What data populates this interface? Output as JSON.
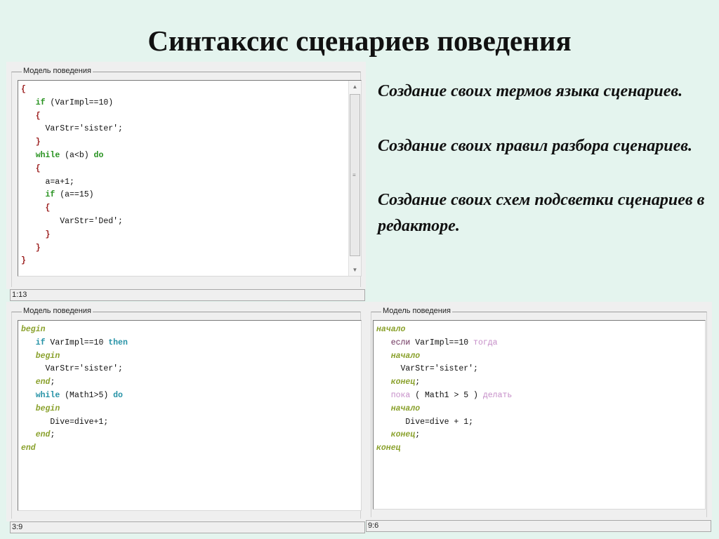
{
  "title": "Синтаксис сценариев поведения",
  "notes": [
    "Создание своих термов языка сценариев.",
    "Создание своих правил разбора сценариев.",
    "Создание своих схем подсветки сценариев в редакторе."
  ],
  "colors": {
    "keyword_green": "#27921f",
    "keyword_teal": "#2592a6",
    "keyword_olive": "#8aa12c",
    "keyword_pink": "#c68ec8",
    "brace_red": "#9c1f1f",
    "background": "#e4f4ee"
  },
  "panels": [
    {
      "label": "Модель поведения",
      "status": "1:13",
      "lines": [
        [
          {
            "t": "{",
            "c": "brace"
          }
        ],
        [
          {
            "t": "   "
          },
          {
            "t": "if",
            "c": "kwg"
          },
          {
            "t": " (VarImpl==10)"
          }
        ],
        [
          {
            "t": "   "
          },
          {
            "t": "{",
            "c": "brace"
          }
        ],
        [
          {
            "t": "     VarStr='sister';"
          }
        ],
        [
          {
            "t": "   "
          },
          {
            "t": "}",
            "c": "brace"
          }
        ],
        [
          {
            "t": "   "
          },
          {
            "t": "while",
            "c": "kwg"
          },
          {
            "t": " (a<b) "
          },
          {
            "t": "do",
            "c": "kwg"
          }
        ],
        [
          {
            "t": "   "
          },
          {
            "t": "{",
            "c": "brace"
          }
        ],
        [
          {
            "t": "     a=a+1;"
          }
        ],
        [
          {
            "t": "     "
          },
          {
            "t": "if",
            "c": "kwg"
          },
          {
            "t": " (a==15)"
          }
        ],
        [
          {
            "t": "     "
          },
          {
            "t": "{",
            "c": "brace"
          }
        ],
        [
          {
            "t": "        VarStr='Ded';"
          }
        ],
        [
          {
            "t": "     "
          },
          {
            "t": "}",
            "c": "brace"
          }
        ],
        [
          {
            "t": "   "
          },
          {
            "t": "}",
            "c": "brace"
          }
        ],
        [
          {
            "t": "}",
            "c": "brace"
          }
        ]
      ]
    },
    {
      "label": "Модель поведения",
      "status": "3:9",
      "lines": [
        [
          {
            "t": "begin",
            "c": "kwo"
          }
        ],
        [
          {
            "t": "   "
          },
          {
            "t": "if",
            "c": "kwt"
          },
          {
            "t": " VarImpl==10 "
          },
          {
            "t": "then",
            "c": "kwt"
          }
        ],
        [
          {
            "t": "   "
          },
          {
            "t": "begin",
            "c": "kwo"
          }
        ],
        [
          {
            "t": "     VarStr='sister';"
          }
        ],
        [
          {
            "t": "   "
          },
          {
            "t": "end",
            "c": "kwo"
          },
          {
            "t": ";"
          }
        ],
        [
          {
            "t": "   "
          },
          {
            "t": "while",
            "c": "kwt"
          },
          {
            "t": " (Math1>5) "
          },
          {
            "t": "do",
            "c": "kwt"
          }
        ],
        [
          {
            "t": "   "
          },
          {
            "t": "begin",
            "c": "kwo"
          }
        ],
        [
          {
            "t": "      Dive=dive+1;"
          }
        ],
        [
          {
            "t": "   "
          },
          {
            "t": "end",
            "c": "kwo"
          },
          {
            "t": ";"
          }
        ],
        [
          {
            "t": "end",
            "c": "kwo"
          }
        ]
      ]
    },
    {
      "label": "Модель поведения",
      "status": "9:6",
      "lines": [
        [
          {
            "t": "начало",
            "c": "kwo"
          }
        ],
        [
          {
            "t": "   "
          },
          {
            "t": "если",
            "c": "kwr"
          },
          {
            "t": " VarImpl==10 "
          },
          {
            "t": "тогда",
            "c": "kwp"
          }
        ],
        [
          {
            "t": "   "
          },
          {
            "t": "начало",
            "c": "kwo"
          }
        ],
        [
          {
            "t": "     VarStr='sister';"
          }
        ],
        [
          {
            "t": "   "
          },
          {
            "t": "конец",
            "c": "kwo"
          },
          {
            "t": ";"
          }
        ],
        [
          {
            "t": "   "
          },
          {
            "t": "пока",
            "c": "kwp"
          },
          {
            "t": " ( Math1 > 5 ) "
          },
          {
            "t": "делать",
            "c": "kwp"
          }
        ],
        [
          {
            "t": "   "
          },
          {
            "t": "начало",
            "c": "kwo"
          }
        ],
        [
          {
            "t": "      Dive=dive + 1;"
          }
        ],
        [
          {
            "t": "   "
          },
          {
            "t": "конец",
            "c": "kwo"
          },
          {
            "t": ";"
          }
        ],
        [
          {
            "t": "конец",
            "c": "kwo"
          }
        ]
      ]
    }
  ]
}
